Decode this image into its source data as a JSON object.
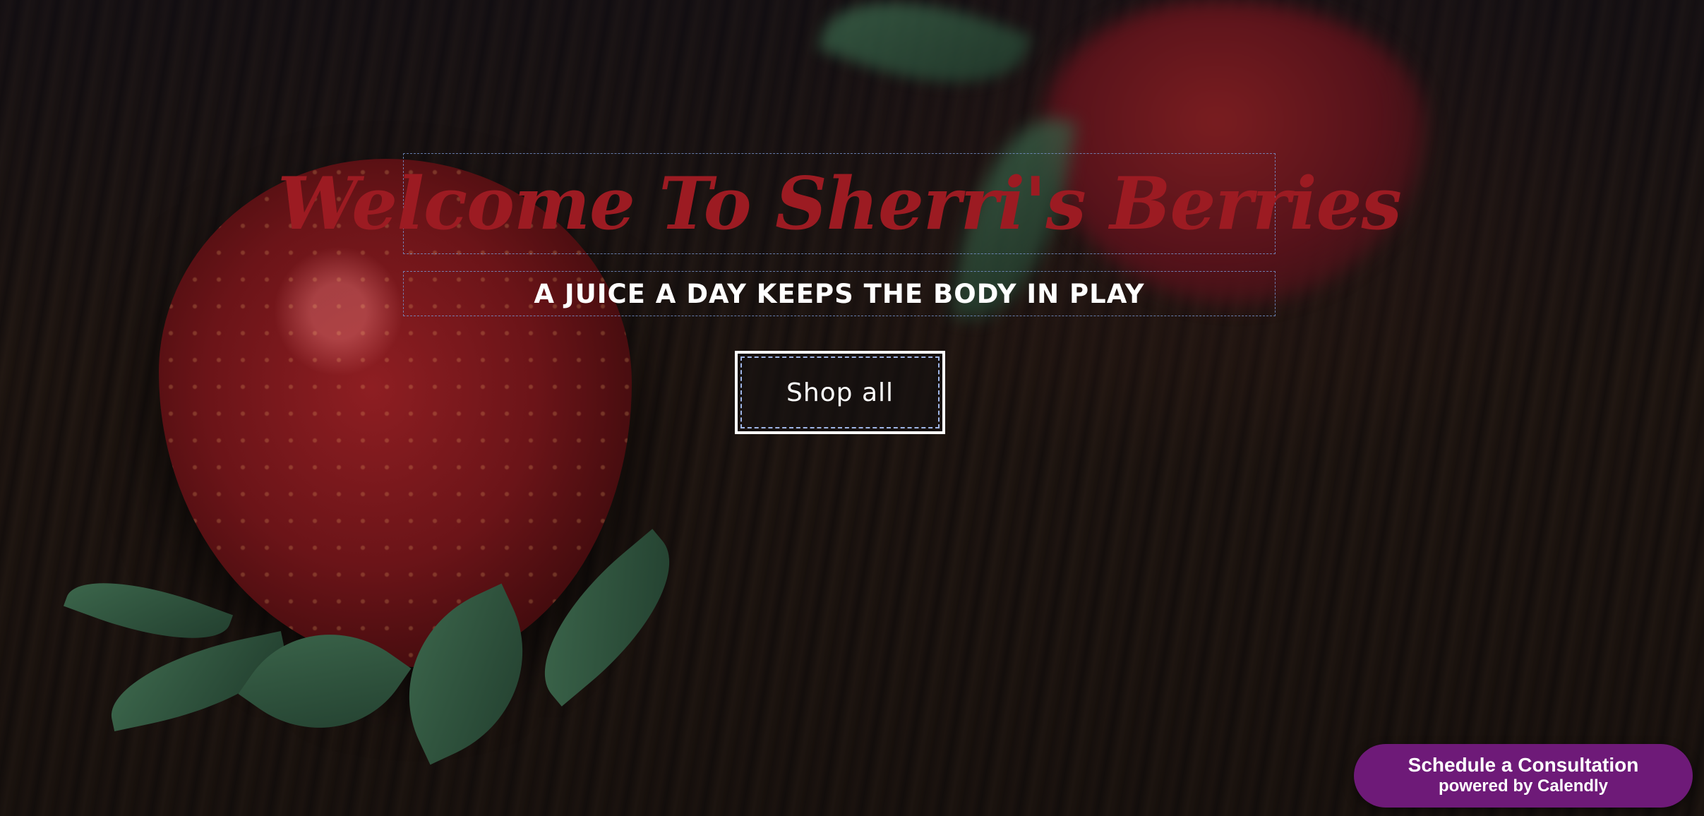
{
  "hero": {
    "title": "Welcome To Sherri's Berries",
    "subtitle": "A JUICE A DAY KEEPS THE BODY IN PLAY",
    "shop_button_label": "Shop all"
  },
  "calendly": {
    "main_label": "Schedule a Consultation",
    "sub_label": "powered by Calendly"
  },
  "colors": {
    "title": "#9c1b22",
    "calendly_bg": "#6e1a78",
    "text_light": "#ffffff"
  }
}
